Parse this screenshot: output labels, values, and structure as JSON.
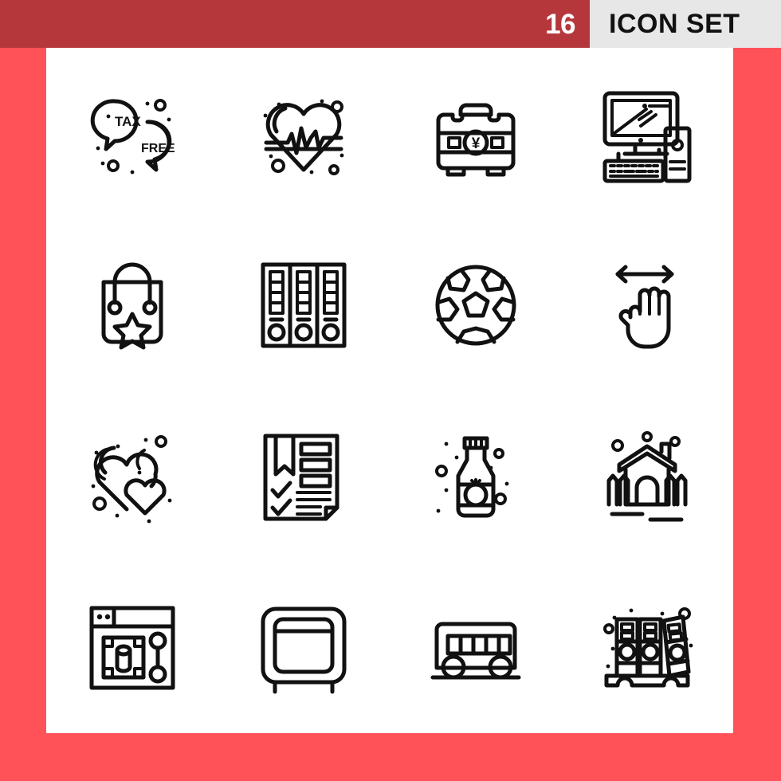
{
  "header": {
    "count": "16",
    "title": "ICON SET",
    "bar_color": "#b5373c",
    "title_block_color": "#e7e7e7",
    "count_text_color": "#ffffff",
    "title_text_color": "#111111"
  },
  "page": {
    "border_color": "#ff5258",
    "canvas_color": "#ffffff",
    "stroke_color": "#111111"
  },
  "icons": [
    {
      "id": "tax-free-speech-bubbles-icon",
      "name": "tax free speech bubbles",
      "label_1": "TAX",
      "label_2": "FREE"
    },
    {
      "id": "heartbeat-pulse-icon",
      "name": "heart with pulse line"
    },
    {
      "id": "briefcase-yen-icon",
      "name": "briefcase with yen symbol",
      "currency": "¥"
    },
    {
      "id": "desktop-computer-icon",
      "name": "desktop computer with keyboard and tower"
    },
    {
      "id": "shopping-bag-star-icon",
      "name": "shopping bag with star"
    },
    {
      "id": "archive-binders-icon",
      "name": "three archive binders"
    },
    {
      "id": "soccer-ball-icon",
      "name": "soccer ball"
    },
    {
      "id": "swipe-horizontal-hand-icon",
      "name": "hand with left right swipe arrows"
    },
    {
      "id": "two-hearts-icon",
      "name": "two hearts"
    },
    {
      "id": "checklist-document-icon",
      "name": "document checklist with bookmark"
    },
    {
      "id": "ketchup-bottle-icon",
      "name": "tomato ketchup bottle"
    },
    {
      "id": "house-fence-icon",
      "name": "house with fence"
    },
    {
      "id": "browser-database-icon",
      "name": "browser window with database node diagram"
    },
    {
      "id": "television-icon",
      "name": "television screen on legs"
    },
    {
      "id": "bus-icon",
      "name": "bus"
    },
    {
      "id": "binder-shelf-icon",
      "name": "binders on shelf"
    }
  ]
}
